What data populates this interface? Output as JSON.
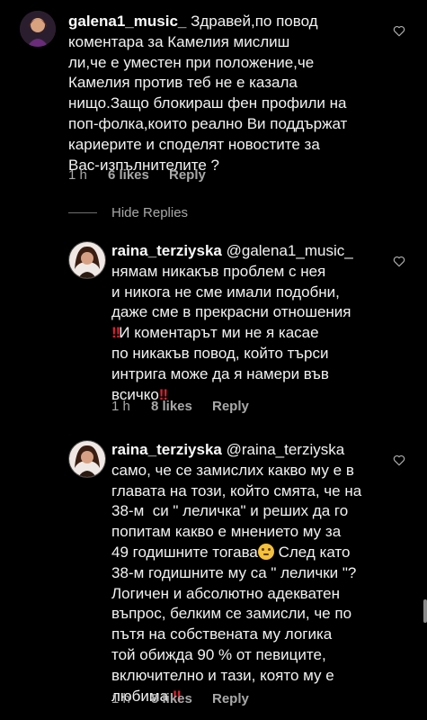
{
  "comments": [
    {
      "username": "galena1_music_",
      "text": "Здравей,по повод\nкоментара за Камелия мислиш\nли,че е уместен при положение,че\nКамелия против теб не е казала\nнищо.Защо блокираш фен профили на\nпоп-фолка,които реално Ви поддържат\nкариерите и споделят новостите за\nВас-изпълнителите ?",
      "time": "1 h",
      "likes": "6 likes",
      "reply": "Reply"
    },
    {
      "username": "raina_terziyska",
      "mention": "@galena1_music_",
      "text_a": "нямам никакъв проблем с нея\nи никога не сме имали подобни,\nдаже сме в прекрасни отношения\n",
      "text_b": "И коментарът ми не я касае\nпо никакъв повод, който търси\nинтрига може да я намери във\nвсичко",
      "time": "1 h",
      "likes": "8 likes",
      "reply": "Reply"
    },
    {
      "username": "raina_terziyska",
      "mention": "@raina_terziyska",
      "text_a": "само, че се замислих какво му е в\nглавата на този, който смята, че на\n38-м  си \" леличка\" и реших да го\nпопитам какво е мнението му за\n49 годишните тогава",
      "text_b": " След като\n38-м годишните му са \" лелички \"?\nЛогичен и абсолютно адекватен\nвъпрос, белким се замисли, че по\nпътя на собствената му логика\nтой обижда 90 % от певиците,\nвключително и тази, която му е\nлюбима ",
      "time": "1 h",
      "likes": "8 likes",
      "reply": "Reply"
    }
  ],
  "hide_replies": "Hide Replies",
  "bang": "‼",
  "colors": {
    "background": "#000000",
    "meta": "#a8a8a8",
    "accent_red": "#e0202e"
  },
  "icons": [
    "heart-outline-icon",
    "thinking-face-emoji",
    "double-exclamation-emoji"
  ]
}
